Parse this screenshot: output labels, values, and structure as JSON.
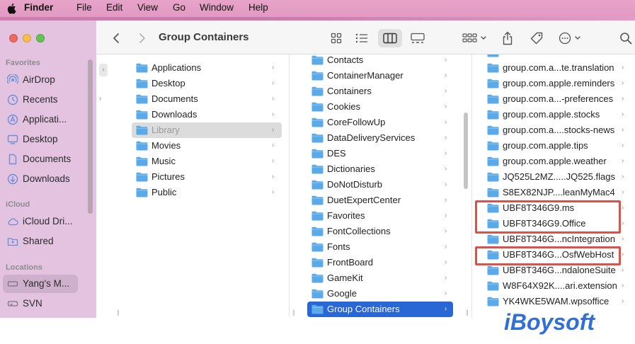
{
  "menubar": {
    "app_name": "Finder",
    "items": [
      "File",
      "Edit",
      "View",
      "Go",
      "Window",
      "Help"
    ]
  },
  "sidebar": {
    "favorites_heading": "Favorites",
    "favorites": [
      {
        "label": "AirDrop",
        "icon": "airdrop-icon"
      },
      {
        "label": "Recents",
        "icon": "clock-icon"
      },
      {
        "label": "Applicati...",
        "icon": "applications-icon"
      },
      {
        "label": "Desktop",
        "icon": "desktop-icon"
      },
      {
        "label": "Documents",
        "icon": "document-icon"
      },
      {
        "label": "Downloads",
        "icon": "download-icon"
      }
    ],
    "icloud_heading": "iCloud",
    "icloud": [
      {
        "label": "iCloud Dri...",
        "icon": "cloud-icon"
      },
      {
        "label": "Shared",
        "icon": "shared-folder-icon"
      }
    ],
    "locations_heading": "Locations",
    "locations": [
      {
        "label": "Yang's M...",
        "icon": "disk-icon",
        "selected": true
      },
      {
        "label": "SVN",
        "icon": "disk-icon"
      }
    ]
  },
  "toolbar": {
    "title": "Group Containers",
    "back_icon": "chevron-left-icon",
    "forward_icon": "chevron-right-icon"
  },
  "columns": {
    "col1": [
      {
        "label": "Applications"
      },
      {
        "label": "Desktop"
      },
      {
        "label": "Documents"
      },
      {
        "label": "Downloads"
      },
      {
        "label": "Library",
        "selected": true
      },
      {
        "label": "Movies"
      },
      {
        "label": "Music"
      },
      {
        "label": "Pictures"
      },
      {
        "label": "Public"
      }
    ],
    "col2": [
      {
        "label": "Contacts"
      },
      {
        "label": "ContainerManager"
      },
      {
        "label": "Containers"
      },
      {
        "label": "Cookies"
      },
      {
        "label": "CoreFollowUp"
      },
      {
        "label": "DataDeliveryServices"
      },
      {
        "label": "DES"
      },
      {
        "label": "Dictionaries"
      },
      {
        "label": "DoNotDisturb"
      },
      {
        "label": "DuetExpertCenter"
      },
      {
        "label": "Favorites"
      },
      {
        "label": "FontCollections"
      },
      {
        "label": "Fonts"
      },
      {
        "label": "FrontBoard"
      },
      {
        "label": "GameKit"
      },
      {
        "label": "Google"
      },
      {
        "label": "Group Containers",
        "selected": true
      }
    ],
    "col3": [
      {
        "label": "group.com.a...te.translation"
      },
      {
        "label": "group.com.apple.reminders"
      },
      {
        "label": "group.com.a...-preferences"
      },
      {
        "label": "group.com.apple.stocks"
      },
      {
        "label": "group.com.a....stocks-news"
      },
      {
        "label": "group.com.apple.tips"
      },
      {
        "label": "group.com.apple.weather"
      },
      {
        "label": "JQ525L2MZ.....JQ525.flags"
      },
      {
        "label": "S8EX82NJP....leanMyMac4"
      },
      {
        "label": "UBF8T346G9.ms"
      },
      {
        "label": "UBF8T346G9.Office"
      },
      {
        "label": "UBF8T346G...ncIntegration"
      },
      {
        "label": "UBF8T346G...OsfWebHost"
      },
      {
        "label": "UBF8T346G...ndaloneSuite"
      },
      {
        "label": "W8F64X92K....ari.extension"
      },
      {
        "label": "YK4WKE5WAM.wpsoffice"
      }
    ]
  },
  "watermark": {
    "text": "iBoysoft"
  },
  "colors": {
    "menubar": "#e29ac2",
    "sidebar": "#e3c3e0",
    "selection_blue": "#2966d6",
    "highlight_red": "#d9534a",
    "folder_blue": "#5aa9e8",
    "watermark_blue": "#2f6fd6"
  }
}
